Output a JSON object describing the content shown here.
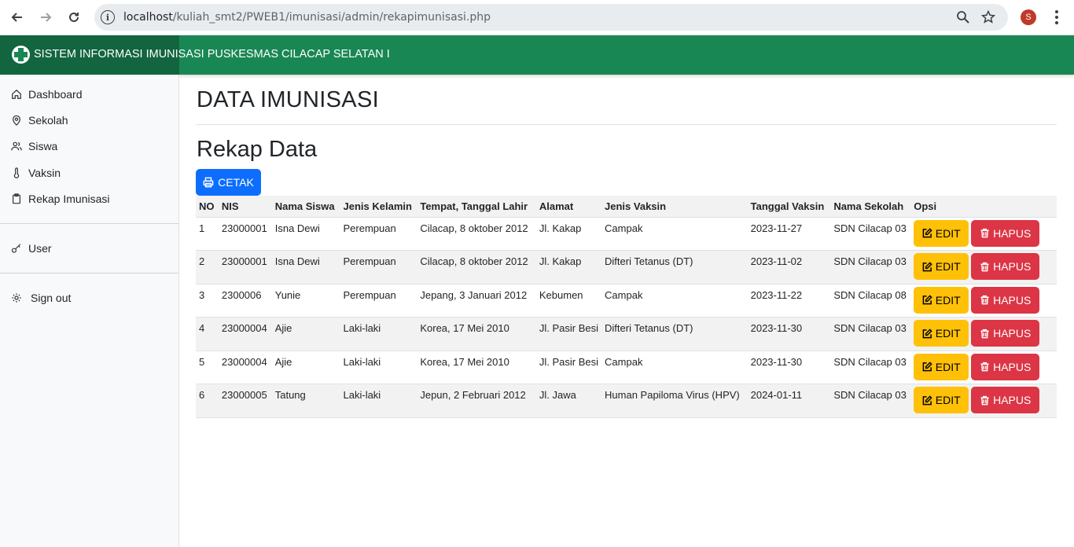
{
  "browser": {
    "url_host": "localhost",
    "url_path": "/kuliah_smt2/PWEB1/imunisasi/admin/rekapimunisasi.php",
    "profile_initial": "S"
  },
  "header": {
    "title": "SISTEM INFORMASI IMUNISASI PUSKESMAS CILACAP SELATAN I"
  },
  "sidebar": {
    "items": [
      {
        "label": "Dashboard",
        "icon": "home-icon"
      },
      {
        "label": "Sekolah",
        "icon": "map-pin-icon"
      },
      {
        "label": "Siswa",
        "icon": "users-icon"
      },
      {
        "label": "Vaksin",
        "icon": "thermometer-icon"
      },
      {
        "label": "Rekap Imunisasi",
        "icon": "clipboard-icon"
      }
    ],
    "user_label": "User",
    "signout_label": "Sign out"
  },
  "main": {
    "title": "DATA IMUNISASI",
    "subtitle": "Rekap Data",
    "print_label": "CETAK"
  },
  "table": {
    "headers": [
      "NO",
      "NIS",
      "Nama Siswa",
      "Jenis Kelamin",
      "Tempat, Tanggal Lahir",
      "Alamat",
      "Jenis Vaksin",
      "Tanggal Vaksin",
      "Nama Sekolah",
      "Opsi"
    ],
    "edit_label": "EDIT",
    "delete_label": "HAPUS",
    "rows": [
      {
        "no": "1",
        "nis": "23000001",
        "nama": "Isna Dewi",
        "jk": "Perempuan",
        "ttl": "Cilacap, 8 oktober 2012",
        "alamat": "Jl. Kakap",
        "vaksin": "Campak",
        "tgl": "2023-11-27",
        "sekolah": "SDN Cilacap 03"
      },
      {
        "no": "2",
        "nis": "23000001",
        "nama": "Isna Dewi",
        "jk": "Perempuan",
        "ttl": "Cilacap, 8 oktober 2012",
        "alamat": "Jl. Kakap",
        "vaksin": "Difteri Tetanus (DT)",
        "tgl": "2023-11-02",
        "sekolah": "SDN Cilacap 03"
      },
      {
        "no": "3",
        "nis": "2300006",
        "nama": "Yunie",
        "jk": "Perempuan",
        "ttl": "Jepang, 3 Januari 2012",
        "alamat": "Kebumen",
        "vaksin": "Campak",
        "tgl": "2023-11-22",
        "sekolah": "SDN Cilacap 08"
      },
      {
        "no": "4",
        "nis": "23000004",
        "nama": "Ajie",
        "jk": "Laki-laki",
        "ttl": "Korea, 17 Mei 2010",
        "alamat": "Jl. Pasir Besi",
        "vaksin": "Difteri Tetanus (DT)",
        "tgl": "2023-11-30",
        "sekolah": "SDN Cilacap 03"
      },
      {
        "no": "5",
        "nis": "23000004",
        "nama": "Ajie",
        "jk": "Laki-laki",
        "ttl": "Korea, 17 Mei 2010",
        "alamat": "Jl. Pasir Besi",
        "vaksin": "Campak",
        "tgl": "2023-11-30",
        "sekolah": "SDN Cilacap 03"
      },
      {
        "no": "6",
        "nis": "23000005",
        "nama": "Tatung",
        "jk": "Laki-laki",
        "ttl": "Jepun, 2 Februari 2012",
        "alamat": "Jl. Jawa",
        "vaksin": "Human Papiloma Virus (HPV)",
        "tgl": "2024-01-11",
        "sekolah": "SDN Cilacap 03"
      }
    ]
  }
}
